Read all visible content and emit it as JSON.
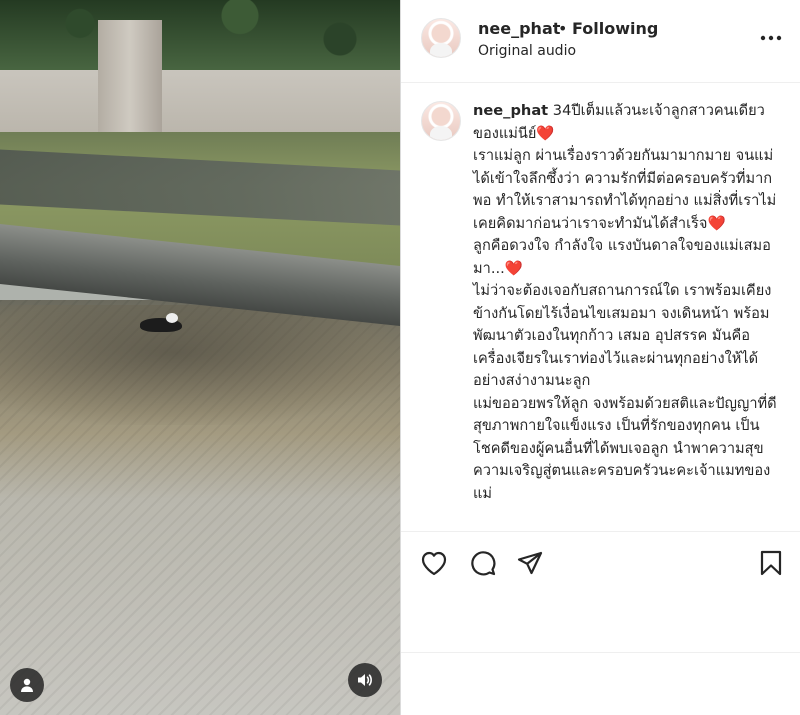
{
  "header": {
    "username": "nee_phat",
    "separator": "•",
    "follow_status": "Following",
    "audio_label": "Original audio",
    "more_icon": "more-dots-icon"
  },
  "caption": {
    "username": "nee_phat",
    "text": "34ปีเต็มแล้วนะเจ้าลูกสาวคนเดียวของแม่นีย์❤️\nเราแม่ลูก ผ่านเรื่องราวด้วยกันมามากมาย จนแม่ได้เข้าใจลึกซึ้งว่า ความรักที่มีต่อครอบครัวที่มากพอ ทำให้เราสามารถทำได้ทุกอย่าง แม่สิ่งที่เราไม่เคยคิดมาก่อนว่าเราจะทำมันได้สำเร็จ❤️\nลูกคือดวงใจ กำลังใจ แรงบันดาลใจของแม่เสมอมา...❤️\nไม่ว่าจะต้องเจอกับสถานการณ์ใด เราพร้อมเคียงข้างกันโดยไร้เงื่อนไขเสมอมา จงเดินหน้า พร้อมพัฒนาตัวเองในทุกก้าว เสมอ อุปสรรค มันคือเครื่องเจียรในเราท่องไว้และผ่านทุกอย่างให้ได้อย่างสง่างามนะลูก\nแม่ขออวยพรให้ลูก จงพร้อมด้วยสติและปัญญาที่ดี สุขภาพกายใจแข็งแรง เป็นที่รักของทุกคน เป็นโชคดีของผู้คนอื่นที่ได้พบเจอลูก นำพาความสุขความเจริญสู่ตนและครอบครัวนะคะเจ้าแมทของแม่"
  },
  "actions": {
    "like_icon": "heart-icon",
    "comment_icon": "comment-bubble-icon",
    "share_icon": "paper-plane-icon",
    "save_icon": "bookmark-icon"
  },
  "media": {
    "user_tag_icon": "user-tag-icon",
    "audio_icon": "speaker-icon"
  },
  "colors": {
    "text": "#262626",
    "divider": "#dbdbdb",
    "overlay_button": "#262626",
    "heart_emoji": "#e0245e"
  }
}
